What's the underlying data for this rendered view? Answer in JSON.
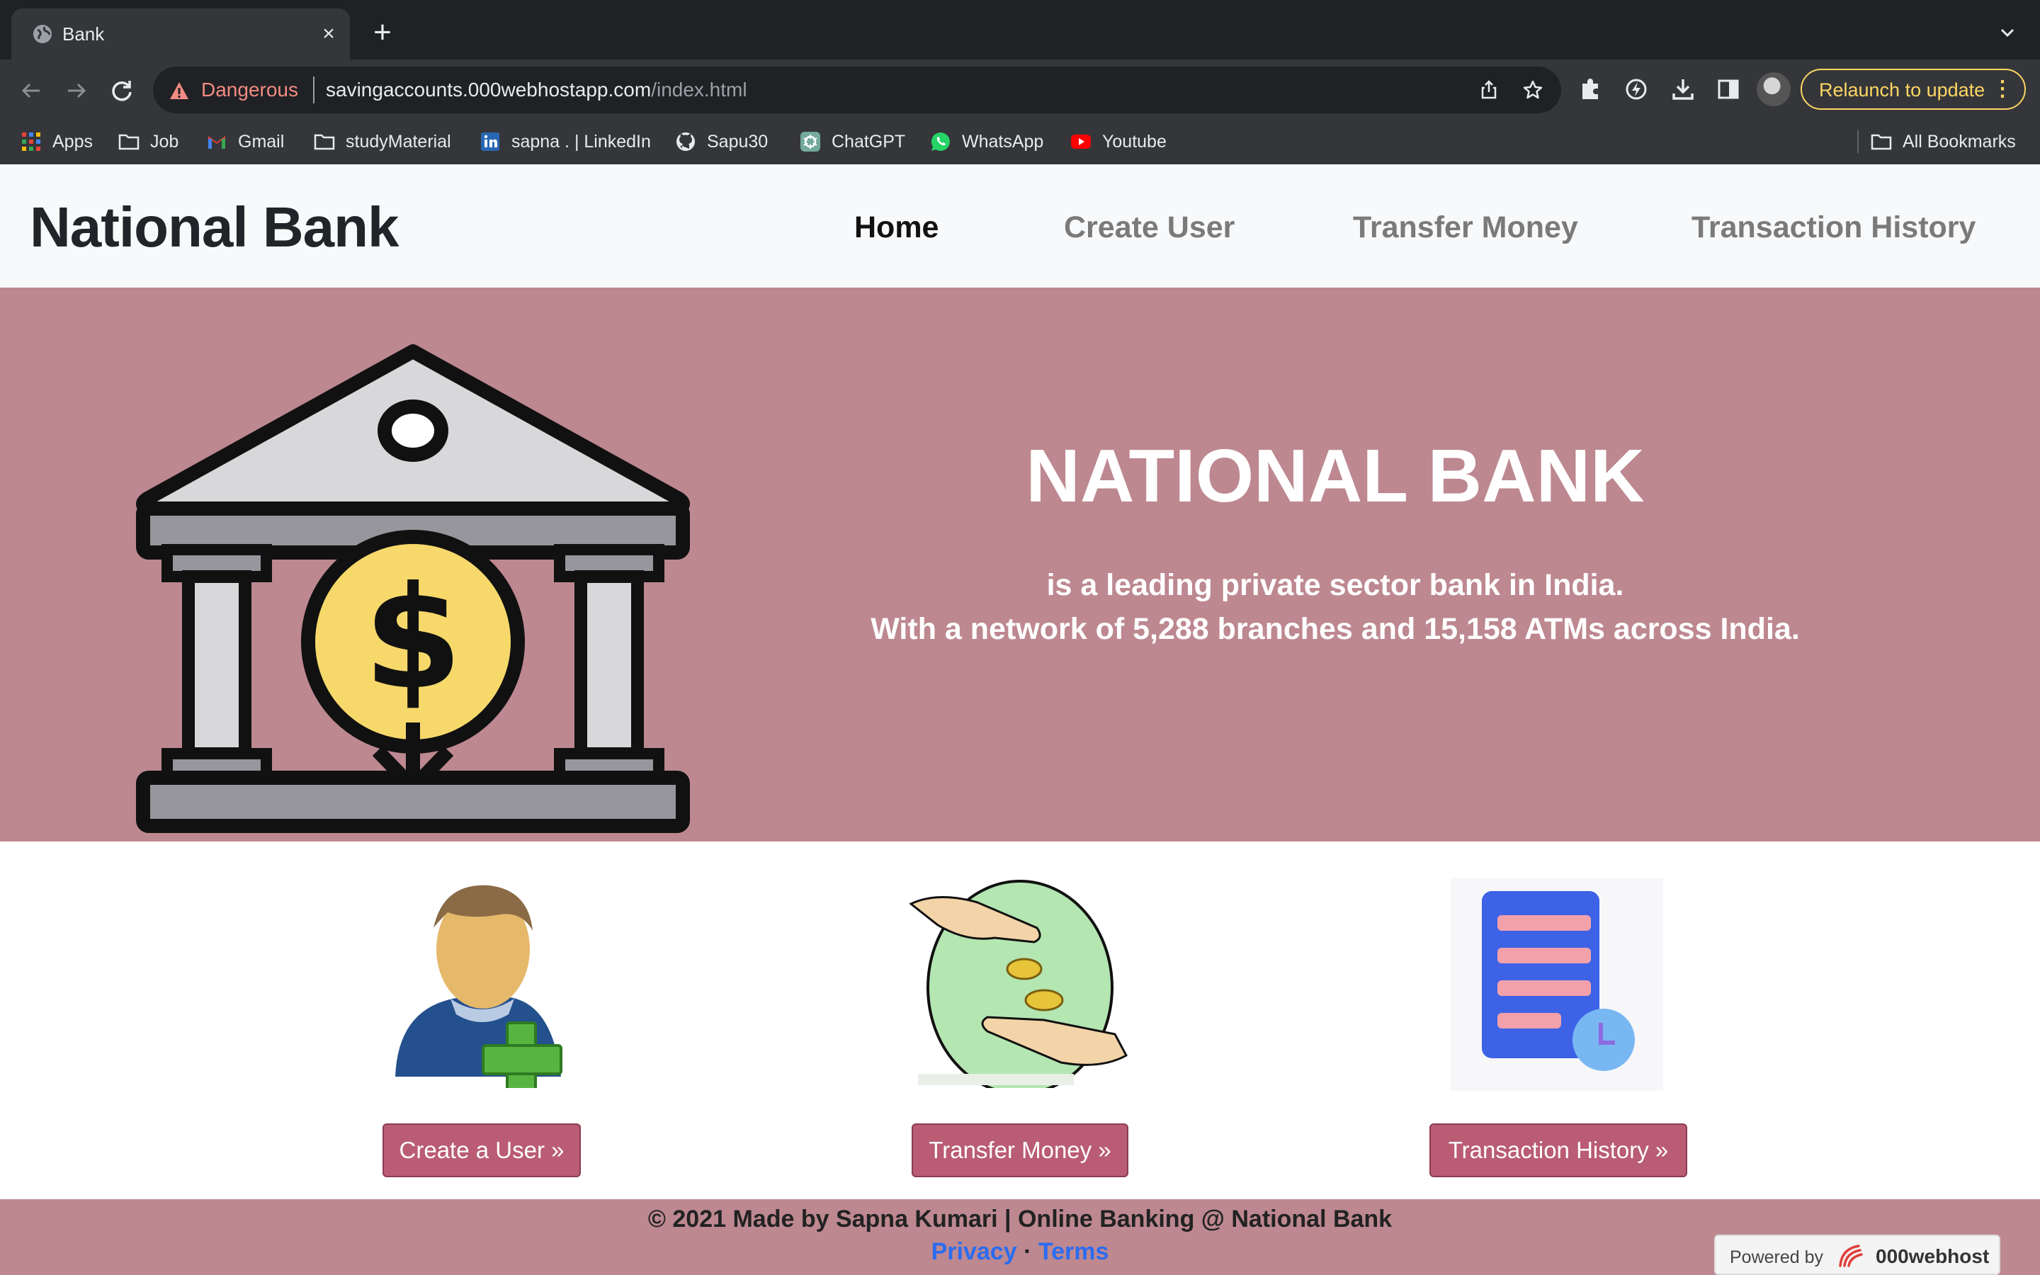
{
  "browser": {
    "tab_title": "Bank",
    "address": {
      "security_label": "Dangerous",
      "url_host": "savingaccounts.000webhostapp.com",
      "url_path": "/index.html"
    },
    "relaunch_label": "Relaunch to update",
    "bookmarks": [
      {
        "label": "Apps",
        "icon": "apps-grid-icon"
      },
      {
        "label": "Job",
        "icon": "folder-icon"
      },
      {
        "label": "Gmail",
        "icon": "gmail-icon"
      },
      {
        "label": "studyMaterial",
        "icon": "folder-icon"
      },
      {
        "label": "sapna . | LinkedIn",
        "icon": "linkedin-icon"
      },
      {
        "label": "Sapu30",
        "icon": "github-icon"
      },
      {
        "label": "ChatGPT",
        "icon": "chatgpt-icon"
      },
      {
        "label": "WhatsApp",
        "icon": "whatsapp-icon"
      },
      {
        "label": "Youtube",
        "icon": "youtube-icon"
      }
    ],
    "all_bookmarks_label": "All Bookmarks",
    "colors": {
      "danger": "#f28b82",
      "relaunch": "#fdd663"
    }
  },
  "site": {
    "brand": "National Bank",
    "nav": [
      {
        "label": "Home",
        "active": true
      },
      {
        "label": "Create User",
        "active": false
      },
      {
        "label": "Transfer Money",
        "active": false
      },
      {
        "label": "Transaction History",
        "active": false
      }
    ],
    "hero": {
      "title": "NATIONAL BANK",
      "line1": "is a leading private sector bank in India.",
      "line2": "With a network of 5,288 branches and 15,158 ATMs across India."
    },
    "features": [
      {
        "button": "Create a User »",
        "icon": "add-user-icon"
      },
      {
        "button": "Transfer Money »",
        "icon": "money-transfer-icon"
      },
      {
        "button": "Transaction History »",
        "icon": "transaction-history-icon"
      }
    ],
    "footer": {
      "text": "© 2021 Made by Sapna Kumari | Online Banking @ National Bank",
      "privacy": "Privacy",
      "separator": "·",
      "terms": "Terms"
    },
    "powered": {
      "label": "Powered by",
      "brand": "000webhost"
    },
    "colors": {
      "hero_bg": "#bd8890",
      "button_bg": "#b95c74",
      "link": "#2b6cf0"
    }
  }
}
